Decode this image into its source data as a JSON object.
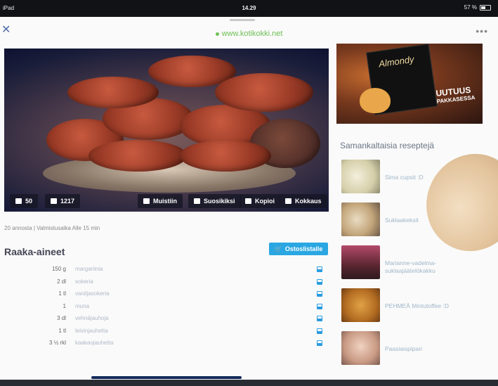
{
  "status": {
    "device": "iPad",
    "time": "14.29",
    "battery": "57 %"
  },
  "browser": {
    "close_icon": "close-icon",
    "url": "www.kotikokki.net",
    "more": "•••"
  },
  "hero": {
    "comments": "50",
    "likes": "1217",
    "actions": [
      {
        "label": "Muistiin",
        "icon": "pin-icon"
      },
      {
        "label": "Suosikiksi",
        "icon": "star-icon"
      },
      {
        "label": "Kopioi",
        "icon": "copy-icon"
      },
      {
        "label": "Kokkaus",
        "icon": "cook-icon"
      }
    ]
  },
  "meta": "20 annosta | Valmistusaika Alle 15 min",
  "ingredients": {
    "title": "Raaka-aineet",
    "shop_label": "Ostoslistalle",
    "items": [
      {
        "qty": "150 g",
        "name": "margariinia"
      },
      {
        "qty": "2 dl",
        "name": "sokeria"
      },
      {
        "qty": "1 tl",
        "name": "vaniljasokeria"
      },
      {
        "qty": "1",
        "name": "muna"
      },
      {
        "qty": "3 dl",
        "name": "vehnäjauhoja"
      },
      {
        "qty": "1 tl",
        "name": "leivinjauhetta"
      },
      {
        "qty": "3 ½ rkl",
        "name": "kaakaojauhetta"
      }
    ]
  },
  "ad": {
    "brand": "Almondy",
    "headline": "UUTUUS",
    "sub": "PAKKASESSA"
  },
  "similar": {
    "title": "Samankaltaisia reseptejä",
    "items": [
      {
        "label": "Sima cupsit :D",
        "color": "#e6e0c8"
      },
      {
        "label": "Suklaakeksit",
        "color": "#c9b79a"
      },
      {
        "label": "Marianne-vadelma-suklaajäätelökakku",
        "color": "#7a3d4a"
      },
      {
        "label": "PEHMEÄ Mintutoffee :D",
        "color": "#c2822e"
      },
      {
        "label": "Paasiaispipari",
        "color": "#d8b49a"
      }
    ]
  }
}
